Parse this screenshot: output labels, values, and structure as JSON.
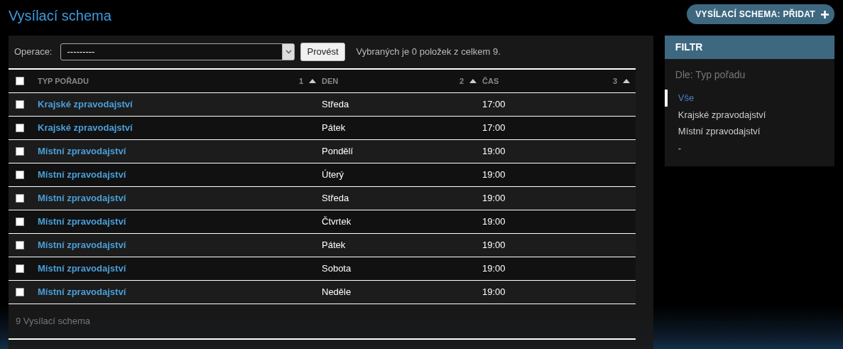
{
  "title": "Vysílací schema",
  "add_button": {
    "label": "VYSÍLACÍ SCHEMA: PŘIDAT"
  },
  "actions": {
    "label": "Operace:",
    "select_value": "---------",
    "button": "Provést",
    "counter": "Vybraných je 0 položek z celkem 9."
  },
  "table": {
    "select_all_checked": false,
    "columns": [
      {
        "label": "TYP POŘADU",
        "sort_priority": "1"
      },
      {
        "label": "DEN",
        "sort_priority": "2"
      },
      {
        "label": "ČAS",
        "sort_priority": "3"
      }
    ],
    "rows": [
      {
        "checked": false,
        "type": "Krajské zpravodajství",
        "day": "Středa",
        "time": "17:00"
      },
      {
        "checked": false,
        "type": "Krajské zpravodajství",
        "day": "Pátek",
        "time": "17:00"
      },
      {
        "checked": false,
        "type": "Místní zpravodajství",
        "day": "Pondělí",
        "time": "19:00"
      },
      {
        "checked": false,
        "type": "Místní zpravodajství",
        "day": "Úterý",
        "time": "19:00"
      },
      {
        "checked": false,
        "type": "Místní zpravodajství",
        "day": "Středa",
        "time": "19:00"
      },
      {
        "checked": false,
        "type": "Místní zpravodajství",
        "day": "Čtvrtek",
        "time": "19:00"
      },
      {
        "checked": false,
        "type": "Místní zpravodajství",
        "day": "Pátek",
        "time": "19:00"
      },
      {
        "checked": false,
        "type": "Místní zpravodajství",
        "day": "Sobota",
        "time": "19:00"
      },
      {
        "checked": false,
        "type": "Místní zpravodajství",
        "day": "Neděle",
        "time": "19:00"
      }
    ],
    "footer": "9 Vysílací schema"
  },
  "filter": {
    "title": "FILTR",
    "heading": "Dle: Typ pořadu",
    "items": [
      {
        "label": "Vše",
        "selected": true
      },
      {
        "label": "Krajské zpravodajství",
        "selected": false
      },
      {
        "label": "Místní zpravodajství",
        "selected": false
      },
      {
        "label": "-",
        "selected": false
      }
    ]
  }
}
